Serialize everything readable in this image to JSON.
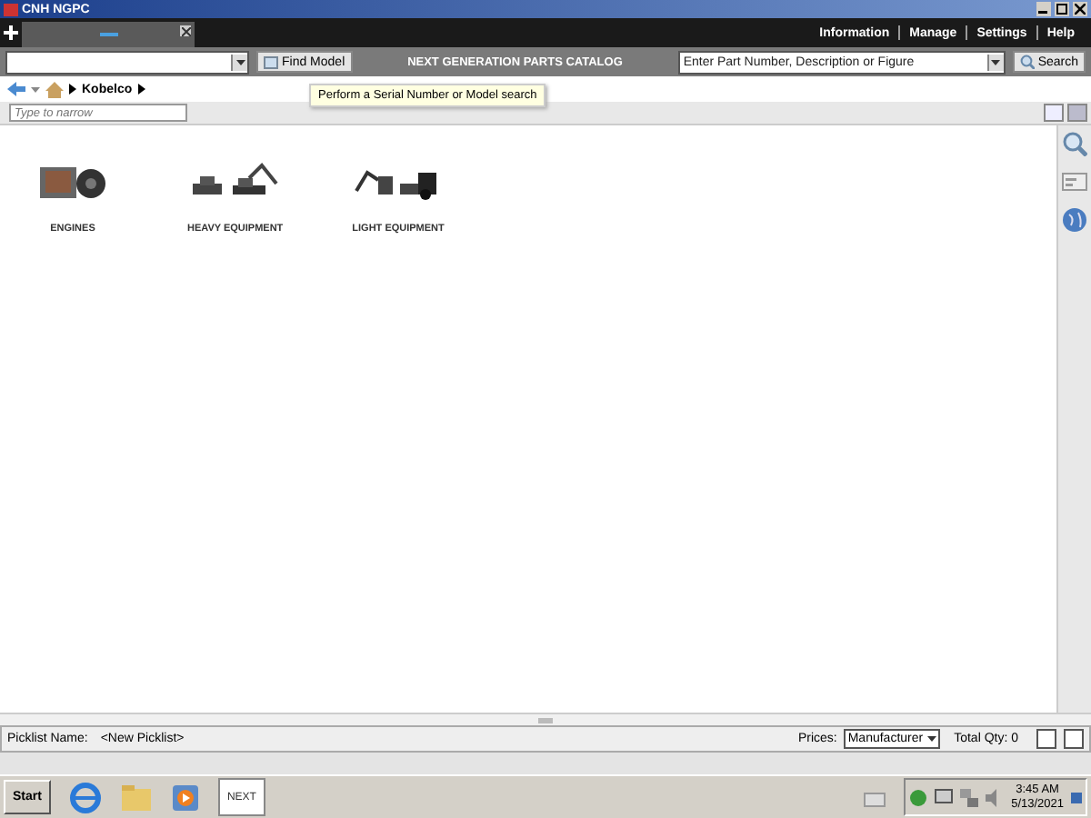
{
  "window": {
    "title": "CNH NGPC"
  },
  "top_nav": [
    "Information",
    "Manage",
    "Settings",
    "Help"
  ],
  "toolbar": {
    "find_button": "Find Model",
    "catalog_title": "NEXT GENERATION PARTS CATALOG",
    "part_search_placeholder": "Enter Part Number, Description or Figure",
    "search_button": "Search",
    "tooltip": "Perform a Serial Number or Model search"
  },
  "breadcrumb": [
    "Kobelco"
  ],
  "filter": {
    "placeholder": "Type to narrow"
  },
  "categories": [
    {
      "kind": "engine",
      "label": "ENGINES"
    },
    {
      "kind": "heavy",
      "label": "HEAVY EQUIPMENT"
    },
    {
      "kind": "light",
      "label": "LIGHT EQUIPMENT"
    }
  ],
  "status_bar": {
    "picklist_label": "Picklist Name:",
    "picklist_value": "<New Picklist>",
    "prices_label": "Prices:",
    "prices_value": "Manufacturer",
    "total": "Total Qty: 0"
  },
  "taskbar": {
    "start": "Start",
    "app": "NEXT",
    "time": "3:45 AM",
    "date": "5/13/2021"
  }
}
